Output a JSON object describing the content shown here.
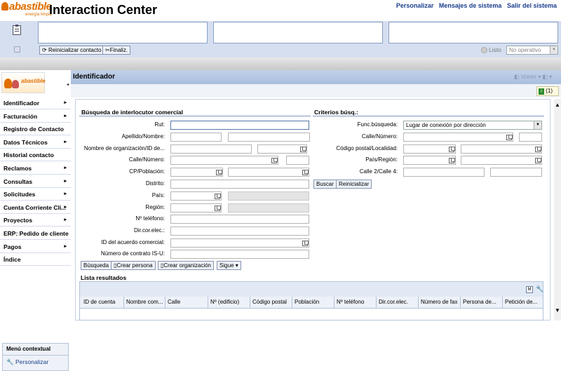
{
  "header": {
    "logo": "abastible",
    "logo_sub": "energía limpia",
    "title": "Interaction Center",
    "links": [
      "Personalizar",
      "Mensajes de sistema",
      "Salir del sistema"
    ]
  },
  "toolbar": {
    "reset_contact": "Reinicializar contacto",
    "finalize": "Finaliz.",
    "status_ready": "Listo",
    "status_value": "No operativo"
  },
  "sidebar": {
    "logo": "abastible",
    "items": [
      {
        "label": "Identificador",
        "arrow": "▸"
      },
      {
        "label": "Facturación",
        "arrow": "▸"
      },
      {
        "label": "Registro de Contacto",
        "arrow": ""
      },
      {
        "label": "Datos Técnicos",
        "arrow": "▸"
      },
      {
        "label": "Historial contacto",
        "arrow": ""
      },
      {
        "label": "Reclamos",
        "arrow": "▸"
      },
      {
        "label": "Consultas",
        "arrow": "▸"
      },
      {
        "label": "Solicitudes",
        "arrow": "▸"
      },
      {
        "label": "Cuenta Corriente Cli...",
        "arrow": "▸"
      },
      {
        "label": "Proyectos",
        "arrow": "▸"
      },
      {
        "label": "ERP: Pedido de cliente",
        "arrow": ""
      },
      {
        "label": "Pagos",
        "arrow": "▸"
      },
      {
        "label": "Índice",
        "arrow": ""
      }
    ],
    "context_menu": "Menú contextual",
    "personalize": "Personalizar"
  },
  "main": {
    "title": "Identificador",
    "back": "Volver",
    "notif_count": "(1)"
  },
  "search": {
    "title": "Búsqueda de interlocutor comercial",
    "labels": [
      "Rut:",
      "Apellido/Nombre:",
      "Nombre de organización/ID de...",
      "Calle/Número:",
      "CP/Población:",
      "Distrito:",
      "País:",
      "Región:",
      "Nº teléfono:",
      "Dir.cor.elec.:",
      "ID del acuerdo comercial:",
      "Número de contrato IS-U:"
    ],
    "buttons": {
      "search": "Búsqueda",
      "create_person": "Crear persona",
      "create_org": "Crear organización",
      "next": "Sigue"
    }
  },
  "criteria": {
    "title": "Criterios búsq.:",
    "func_label": "Func.búsqueda:",
    "func_value": "Lugar de conexión por dirección",
    "labels": [
      "Calle/Número:",
      "Código postal/Localidad:",
      "País/Región:",
      "Calle 2/Calle 4:"
    ],
    "buttons": {
      "search": "Buscar",
      "reset": "Reinicializar"
    }
  },
  "results": {
    "title": "Lista resultados",
    "columns": [
      "ID de cuenta",
      "Nombre com...",
      "Calle",
      "Nº (edificio)",
      "Código postal",
      "Población",
      "Nº teléfono",
      "Dir.cor.elec.",
      "Número de fax",
      "Persona de...",
      "Petición de..."
    ]
  }
}
